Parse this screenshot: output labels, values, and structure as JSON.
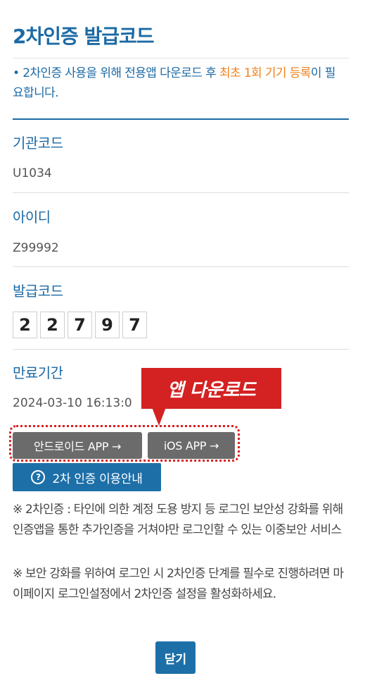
{
  "title": "2차인증 발급코드",
  "notice": {
    "bullet": "•",
    "text_before": "2차인증 사용을 위해 전용앱 다운로드 후 ",
    "highlight": "최초 1회 기기 등록",
    "text_after": "이 필요합니다."
  },
  "fields": {
    "org_code_label": "기관코드",
    "org_code_value": "U1034",
    "user_id_label": "아이디",
    "user_id_value": "Z99992",
    "issue_code_label": "발급코드",
    "issue_code_digits": [
      "2",
      "2",
      "7",
      "9",
      "7"
    ],
    "expiry_label": "만료기간",
    "expiry_value": "2024-03-10 16:13:0"
  },
  "callout": {
    "text": "앱 다운로드"
  },
  "buttons": {
    "android": "안드로이드 APP →",
    "ios": "iOS APP →",
    "guide": "2차 인증 이용안내",
    "guide_icon": "?",
    "close": "닫기"
  },
  "notes": [
    "※ 2차인증 : 타인에 의한 계정 도용 방지 등 로그인 보안성 강화를 위해 인증앱을 통한 추가인증을 거쳐야만 로그인할 수 있는 이중보안 서비스",
    "※ 보안 강화를 위하여 로그인 시 2차인증 단계를 필수로 진행하려면 마이페이지 로그인설정에서 2차인증 설정을 활성화하세요."
  ],
  "colors": {
    "primary": "#1b6aa5",
    "highlight": "#ef7f1a",
    "callout": "#d42121",
    "app_button": "#6b6b6b"
  }
}
